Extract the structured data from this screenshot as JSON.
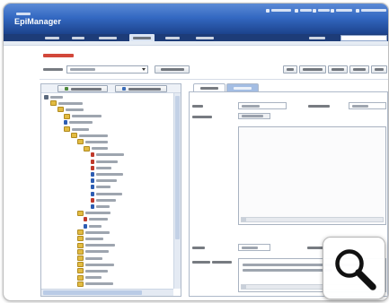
{
  "app": {
    "logo_text": "EpiManager"
  },
  "colors": {
    "header": "#3469c2",
    "header-dark": "#1c438c",
    "nav": "#1d3c78",
    "accent-red": "#d2473a",
    "folder": "#e2bb42",
    "doc-red": "#c0392b",
    "doc-blue": "#2d5db3",
    "panel-border": "#aeb9c9",
    "tab-inactive": "#a3bde3"
  },
  "icons": {
    "root": "tree-root-icon",
    "folder": "folder-icon",
    "doc-red": "document-icon",
    "doc-blue": "document-icon",
    "dropdown": "chevron-down-icon",
    "zoom": "magnifier-icon"
  },
  "tree": {
    "rows": [
      {
        "depth": 0,
        "icon": "root"
      },
      {
        "depth": 1,
        "icon": "folder"
      },
      {
        "depth": 2,
        "icon": "folder"
      },
      {
        "depth": 3,
        "icon": "folder"
      },
      {
        "depth": 3,
        "icon": "doc-blue"
      },
      {
        "depth": 3,
        "icon": "folder"
      },
      {
        "depth": 4,
        "icon": "folder"
      },
      {
        "depth": 5,
        "icon": "folder"
      },
      {
        "depth": 6,
        "icon": "folder"
      },
      {
        "depth": 7,
        "icon": "doc-red"
      },
      {
        "depth": 7,
        "icon": "doc-red"
      },
      {
        "depth": 7,
        "icon": "doc-red"
      },
      {
        "depth": 7,
        "icon": "doc-blue"
      },
      {
        "depth": 7,
        "icon": "doc-blue"
      },
      {
        "depth": 7,
        "icon": "doc-blue"
      },
      {
        "depth": 7,
        "icon": "doc-blue"
      },
      {
        "depth": 7,
        "icon": "doc-red"
      },
      {
        "depth": 7,
        "icon": "doc-blue"
      },
      {
        "depth": 5,
        "icon": "folder"
      },
      {
        "depth": 6,
        "icon": "doc-red"
      },
      {
        "depth": 6,
        "icon": "doc-blue"
      },
      {
        "depth": 5,
        "icon": "folder"
      },
      {
        "depth": 5,
        "icon": "folder"
      },
      {
        "depth": 5,
        "icon": "folder"
      },
      {
        "depth": 5,
        "icon": "folder"
      },
      {
        "depth": 5,
        "icon": "folder"
      },
      {
        "depth": 5,
        "icon": "folder"
      },
      {
        "depth": 5,
        "icon": "folder"
      },
      {
        "depth": 5,
        "icon": "folder"
      },
      {
        "depth": 5,
        "icon": "folder"
      }
    ]
  }
}
